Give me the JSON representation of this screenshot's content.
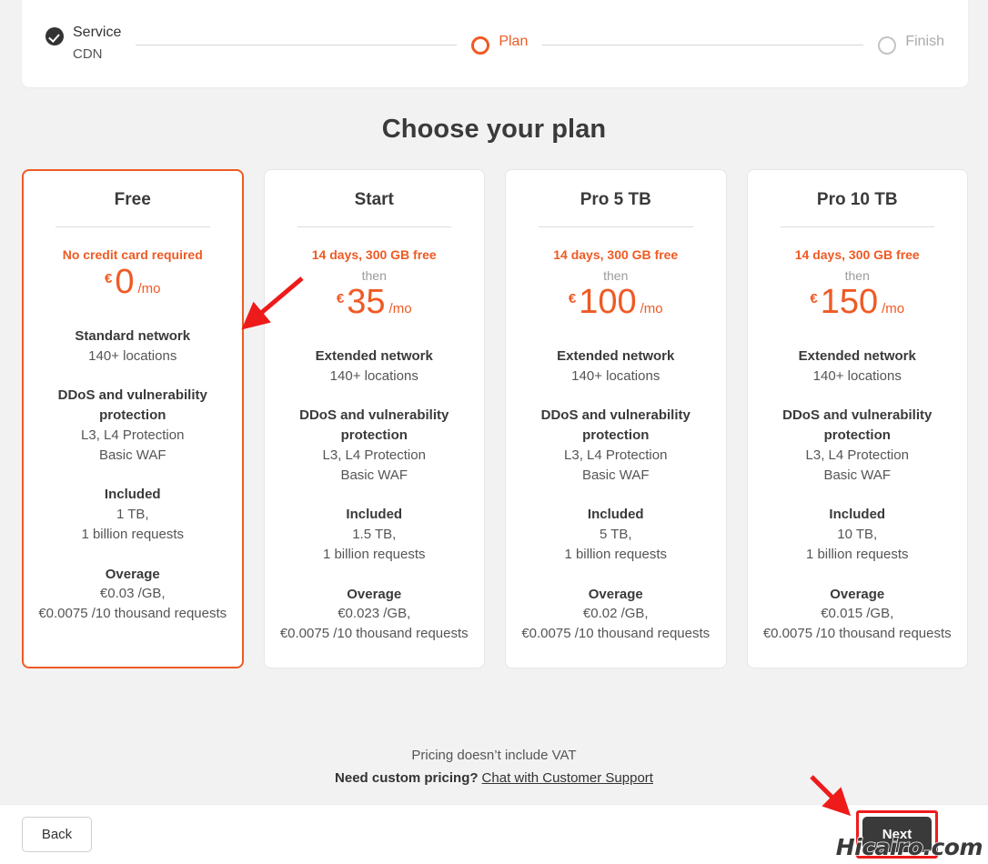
{
  "stepper": {
    "steps": [
      {
        "title": "Service",
        "sub": "CDN",
        "state": "done",
        "icon": "check-circle-icon"
      },
      {
        "title": "Plan",
        "sub": "",
        "state": "current",
        "icon": "circle-icon"
      },
      {
        "title": "Finish",
        "sub": "",
        "state": "todo",
        "icon": "circle-icon"
      }
    ]
  },
  "page": {
    "title": "Choose your plan"
  },
  "plans": [
    {
      "name": "Free",
      "selected": true,
      "promo": "No credit card required",
      "then": "",
      "currency": "€",
      "amount": "0",
      "per": "/mo",
      "network_title": "Standard network",
      "network_sub": "140+ locations",
      "protection_title": "DDoS and vulnerability protection",
      "protection_line1": "L3, L4 Protection",
      "protection_line2": "Basic WAF",
      "included_title": "Included",
      "included_line1": "1 TB,",
      "included_line2": "1 billion requests",
      "overage_title": "Overage",
      "overage_line1": "€0.03 /GB,",
      "overage_line2": "€0.0075 /10 thousand requests"
    },
    {
      "name": "Start",
      "selected": false,
      "promo": "14 days, 300 GB free",
      "then": "then",
      "currency": "€",
      "amount": "35",
      "per": "/mo",
      "network_title": "Extended network",
      "network_sub": "140+ locations",
      "protection_title": "DDoS and vulnerability protection",
      "protection_line1": "L3, L4 Protection",
      "protection_line2": "Basic WAF",
      "included_title": "Included",
      "included_line1": "1.5 TB,",
      "included_line2": "1 billion requests",
      "overage_title": "Overage",
      "overage_line1": "€0.023 /GB,",
      "overage_line2": "€0.0075 /10 thousand requests"
    },
    {
      "name": "Pro 5 TB",
      "selected": false,
      "promo": "14 days, 300 GB free",
      "then": "then",
      "currency": "€",
      "amount": "100",
      "per": "/mo",
      "network_title": "Extended network",
      "network_sub": "140+ locations",
      "protection_title": "DDoS and vulnerability protection",
      "protection_line1": "L3, L4 Protection",
      "protection_line2": "Basic WAF",
      "included_title": "Included",
      "included_line1": "5 TB,",
      "included_line2": "1 billion requests",
      "overage_title": "Overage",
      "overage_line1": "€0.02 /GB,",
      "overage_line2": "€0.0075 /10 thousand requests"
    },
    {
      "name": "Pro 10 TB",
      "selected": false,
      "promo": "14 days, 300 GB free",
      "then": "then",
      "currency": "€",
      "amount": "150",
      "per": "/mo",
      "network_title": "Extended network",
      "network_sub": "140+ locations",
      "protection_title": "DDoS and vulnerability protection",
      "protection_line1": "L3, L4 Protection",
      "protection_line2": "Basic WAF",
      "included_title": "Included",
      "included_line1": "10 TB,",
      "included_line2": "1 billion requests",
      "overage_title": "Overage",
      "overage_line1": "€0.015 /GB,",
      "overage_line2": "€0.0075 /10 thousand requests"
    }
  ],
  "notes": {
    "vat": "Pricing doesn’t include VAT",
    "custom_label": "Need custom pricing?",
    "support_link": "Chat with Customer Support"
  },
  "footer": {
    "back_label": "Back",
    "next_label": "Next"
  },
  "watermark": {
    "text": "Hicairo.com"
  },
  "colors": {
    "accent": "#ef5a24",
    "annotation": "#ee1b1b",
    "dark": "#3a3a3a",
    "page_bg": "#f2f2f2"
  }
}
